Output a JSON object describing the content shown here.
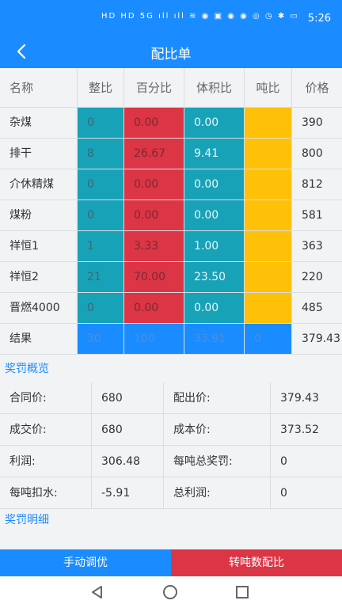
{
  "status": {
    "time": "5:26",
    "icons": "HD HD 5G ıll ıll ≋ ◉ ▣ ◉ ◉ ◎ ◷ ✱ ▭"
  },
  "appbar": {
    "title": "配比单"
  },
  "table": {
    "headers": [
      "名称",
      "整比",
      "百分比",
      "体积比",
      "吨比",
      "价格"
    ],
    "rows": [
      {
        "name": "杂煤",
        "ratio": "0",
        "percent": "0.00",
        "volume": "0.00",
        "ton": "",
        "price": "390"
      },
      {
        "name": "排干",
        "ratio": "8",
        "percent": "26.67",
        "volume": "9.41",
        "ton": "",
        "price": "800"
      },
      {
        "name": "介休精煤",
        "ratio": "0",
        "percent": "0.00",
        "volume": "0.00",
        "ton": "",
        "price": "812"
      },
      {
        "name": "煤粉",
        "ratio": "0",
        "percent": "0.00",
        "volume": "0.00",
        "ton": "",
        "price": "581"
      },
      {
        "name": "祥恒1",
        "ratio": "1",
        "percent": "3.33",
        "volume": "1.00",
        "ton": "",
        "price": "363"
      },
      {
        "name": "祥恒2",
        "ratio": "21",
        "percent": "70.00",
        "volume": "23.50",
        "ton": "",
        "price": "220"
      },
      {
        "name": "晋燃4000",
        "ratio": "0",
        "percent": "0.00",
        "volume": "0.00",
        "ton": "",
        "price": "485"
      }
    ],
    "result": {
      "name": "结果",
      "ratio": "30",
      "percent": "100",
      "volume": "33.91",
      "ton": "0",
      "price": "379.43"
    }
  },
  "sections": {
    "overview": "奖罚概览",
    "details": "奖罚明细"
  },
  "summary": [
    {
      "l1": "合同价:",
      "v1": "680",
      "l2": "配出价:",
      "v2": "379.43"
    },
    {
      "l1": "成交价:",
      "v1": "680",
      "l2": "成本价:",
      "v2": "373.52"
    },
    {
      "l1": "利润:",
      "v1": "306.48",
      "l2": "每吨总奖罚:",
      "v2": "0"
    },
    {
      "l1": "每吨扣水:",
      "v1": "-5.91",
      "l2": "总利润:",
      "v2": "0"
    }
  ],
  "buttons": {
    "manual": "手动调优",
    "convert": "转吨数配比"
  },
  "colors": {
    "primary": "#1a8cff",
    "teal": "#18a2b8",
    "red": "#dc3545",
    "yellow": "#ffc107"
  }
}
